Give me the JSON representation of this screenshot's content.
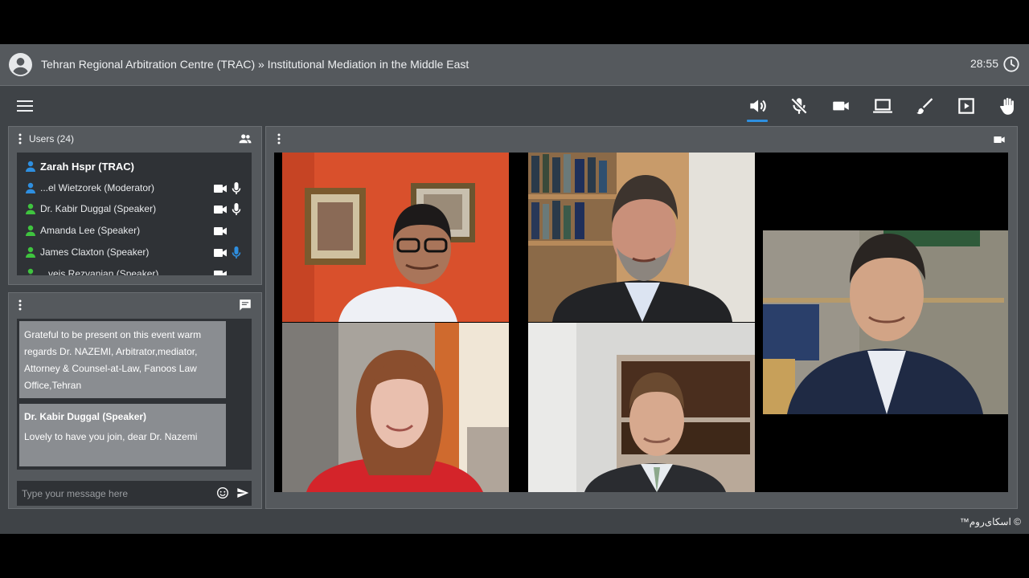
{
  "header": {
    "title": "Tehran Regional Arbitration Centre (TRAC) » Institutional Mediation in the Middle East",
    "timer": "28:55"
  },
  "toolbar": {
    "tools": [
      {
        "name": "speaker",
        "active": true
      },
      {
        "name": "mic-muted",
        "active": false
      },
      {
        "name": "camera",
        "active": false
      },
      {
        "name": "screen-share",
        "active": false
      },
      {
        "name": "whiteboard",
        "active": false
      },
      {
        "name": "media-player",
        "active": false
      },
      {
        "name": "raise-hand",
        "active": false
      }
    ]
  },
  "users": {
    "title": "Users (24)",
    "list": [
      {
        "name": "Zarah Hspr (TRAC)",
        "role_color": "#2e8fe0",
        "bold": true,
        "cam": false,
        "mic": ""
      },
      {
        "name": "...el Wietzorek (Moderator)",
        "role_color": "#2e8fe0",
        "bold": false,
        "cam": true,
        "mic": "#ffffff"
      },
      {
        "name": "Dr. Kabir Duggal (Speaker)",
        "role_color": "#3fc43f",
        "bold": false,
        "cam": true,
        "mic": "#ffffff"
      },
      {
        "name": "Amanda Lee (Speaker)",
        "role_color": "#3fc43f",
        "bold": false,
        "cam": true,
        "mic": ""
      },
      {
        "name": "James Claxton (Speaker)",
        "role_color": "#3fc43f",
        "bold": false,
        "cam": true,
        "mic": "#2e8fe0"
      },
      {
        "name": "...veis Rezvanian (Speaker)",
        "role_color": "#3fc43f",
        "bold": false,
        "cam": true,
        "mic": ""
      }
    ]
  },
  "chat": {
    "messages": [
      {
        "text": "Grateful to be present on this event warm regards Dr. NAZEMI, Arbitrator,mediator, Attorney & Counsel-at-Law, Fanoos Law Office,Tehran"
      },
      {
        "author": "Dr. Kabir Duggal (Speaker)",
        "text": "Lovely to have you join, dear Dr. Nazemi"
      }
    ],
    "placeholder": "Type your message here"
  },
  "footer": {
    "watermark": "© اسکای‌روم™"
  }
}
